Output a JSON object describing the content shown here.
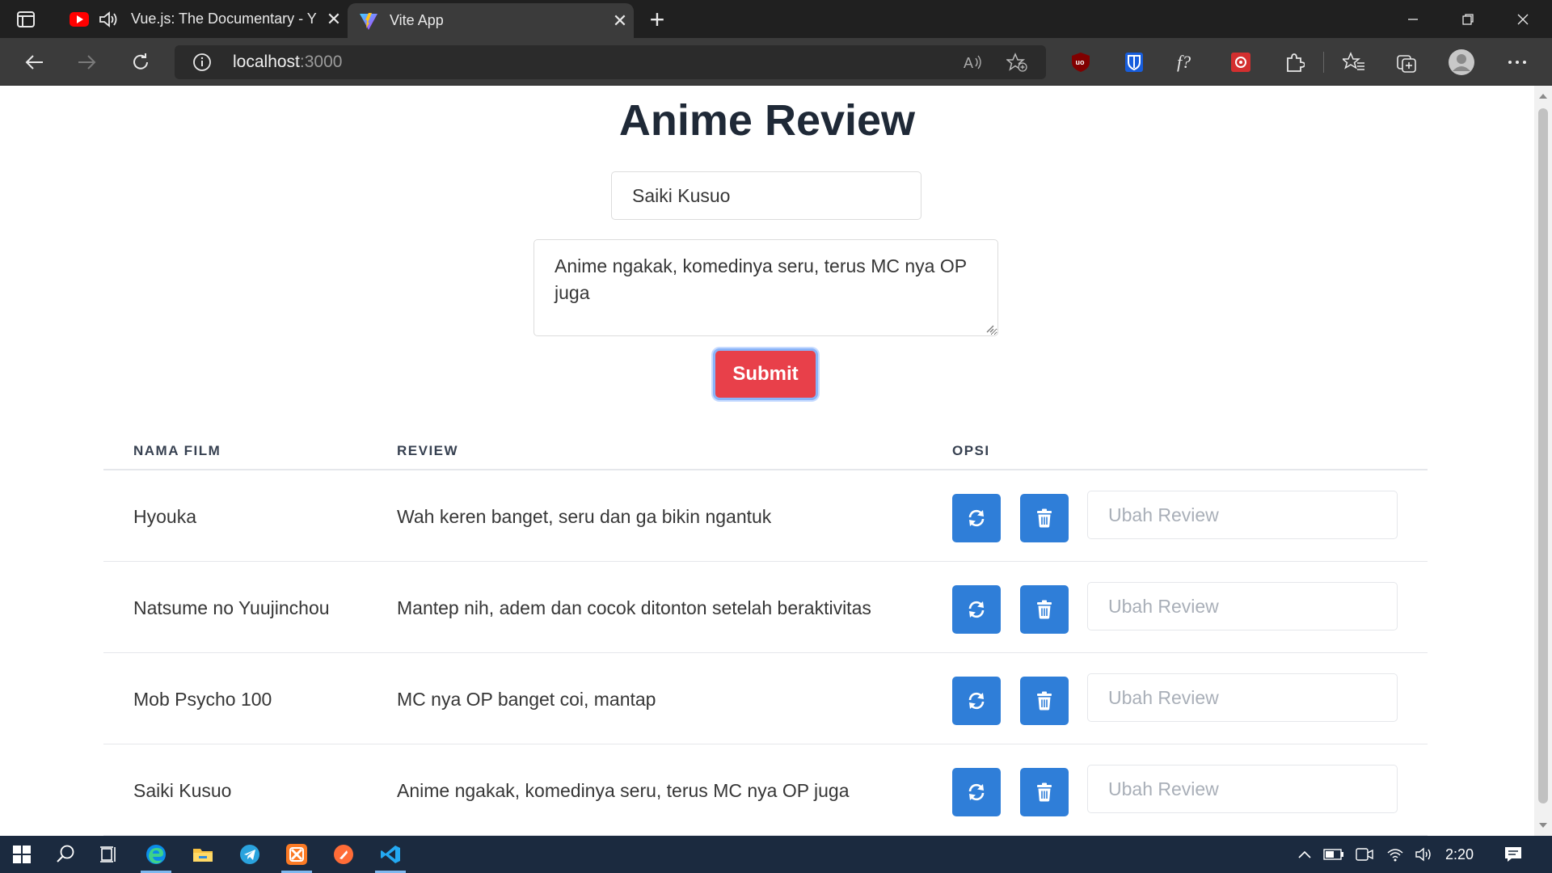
{
  "browser": {
    "tabs": [
      {
        "title": "Vue.js: The Documentary - Y",
        "favicon": "youtube-icon",
        "audio": true,
        "active": false
      },
      {
        "title": "Vite App",
        "favicon": "vite-icon",
        "active": true
      }
    ],
    "address": {
      "host": "localhost",
      "port": ":3000"
    }
  },
  "page": {
    "title": "Anime Review",
    "form": {
      "name_value": "Saiki Kusuo",
      "review_value": "Anime ngakak, komedinya seru, terus MC nya OP juga",
      "submit_label": "Submit"
    },
    "table": {
      "headers": [
        "NAMA FILM",
        "REVIEW",
        "OPSI"
      ],
      "edit_placeholder": "Ubah Review",
      "rows": [
        {
          "name": "Hyouka",
          "review": "Wah keren banget, seru dan ga bikin ngantuk"
        },
        {
          "name": "Natsume no Yuujinchou",
          "review": "Mantep nih, adem dan cocok ditonton setelah beraktivitas"
        },
        {
          "name": "Mob Psycho 100",
          "review": "MC nya OP banget coi, mantap"
        },
        {
          "name": "Saiki Kusuo",
          "review": "Anime ngakak, komedinya seru, terus MC nya OP juga"
        }
      ]
    }
  },
  "colors": {
    "submit": "#e8404a",
    "action_button": "#2f7ed8",
    "title": "#1f2937"
  },
  "taskbar": {
    "time": "2:20"
  }
}
